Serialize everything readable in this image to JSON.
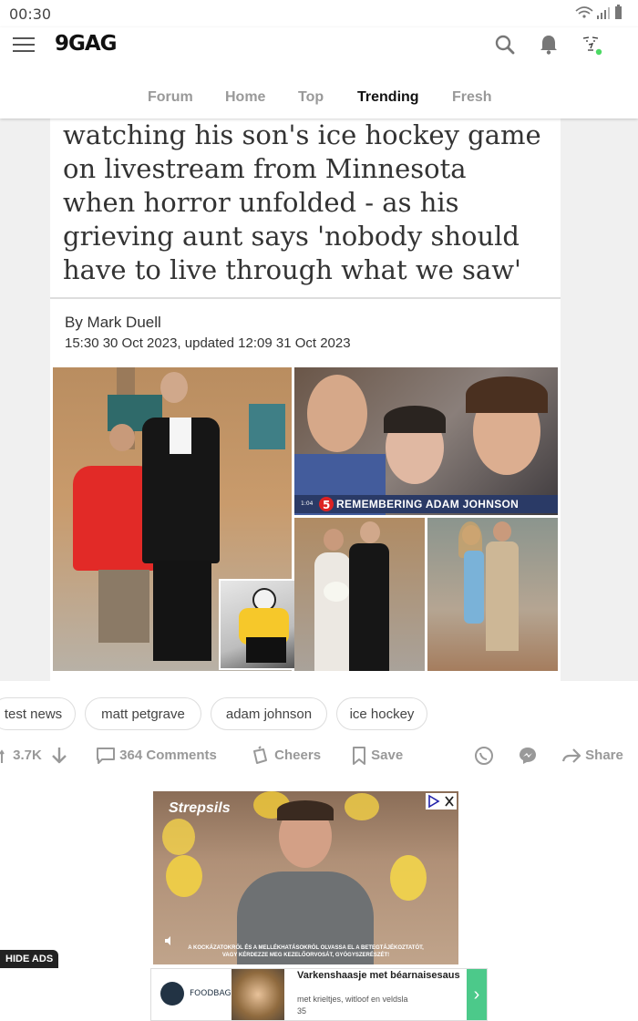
{
  "status_bar": {
    "time": "00:30"
  },
  "header": {
    "logo": "9GAG",
    "tabs": [
      {
        "label": "Forum"
      },
      {
        "label": "Home"
      },
      {
        "label": "Top"
      },
      {
        "label": "Trending"
      },
      {
        "label": "Fresh"
      }
    ],
    "active_tab": "Trending"
  },
  "post": {
    "headline": "watching his son's ice hockey game\non livestream from Minnesota\nwhen horror unfolded - as his\ngrieving aunt says 'nobody should\nhave to live through what we saw'",
    "byline": "By Mark Duell",
    "date": "15:30 30 Oct 2023, updated 12:09 31 Oct 2023",
    "photo_banner": "REMEMBERING ADAM JOHNSON"
  },
  "tags": [
    "test news",
    "matt petgrave",
    "adam johnson",
    "ice hockey"
  ],
  "actions": {
    "upvotes": "3.7K",
    "comments": "364 Comments",
    "cheers": "Cheers",
    "save": "Save",
    "share": "Share"
  },
  "ad": {
    "brand": "Strepsils",
    "fine_print_1": "A KOCKÁZATOKRÓL ÉS A MELLÉKHATÁSOKRÓL OLVASSA EL A BETEGTÁJÉKOZTATÓT,",
    "fine_print_2": "VAGY KÉRDEZZE MEG KEZELŐORVOSÁT, GYÓGYSZERÉSZÉT!",
    "hide_ads": "HIDE ADS"
  },
  "bottom_ad": {
    "brand": "FOODBAG",
    "title": "Varkenshaasje met béarnaisesaus",
    "subtitle": "met krieltjes, witloof en veldsla",
    "number": "35"
  },
  "colors": {
    "active_tab": "#111111",
    "inactive_tab": "#999999",
    "online_dot": "#4cd964",
    "banner": "#2a3a66"
  }
}
